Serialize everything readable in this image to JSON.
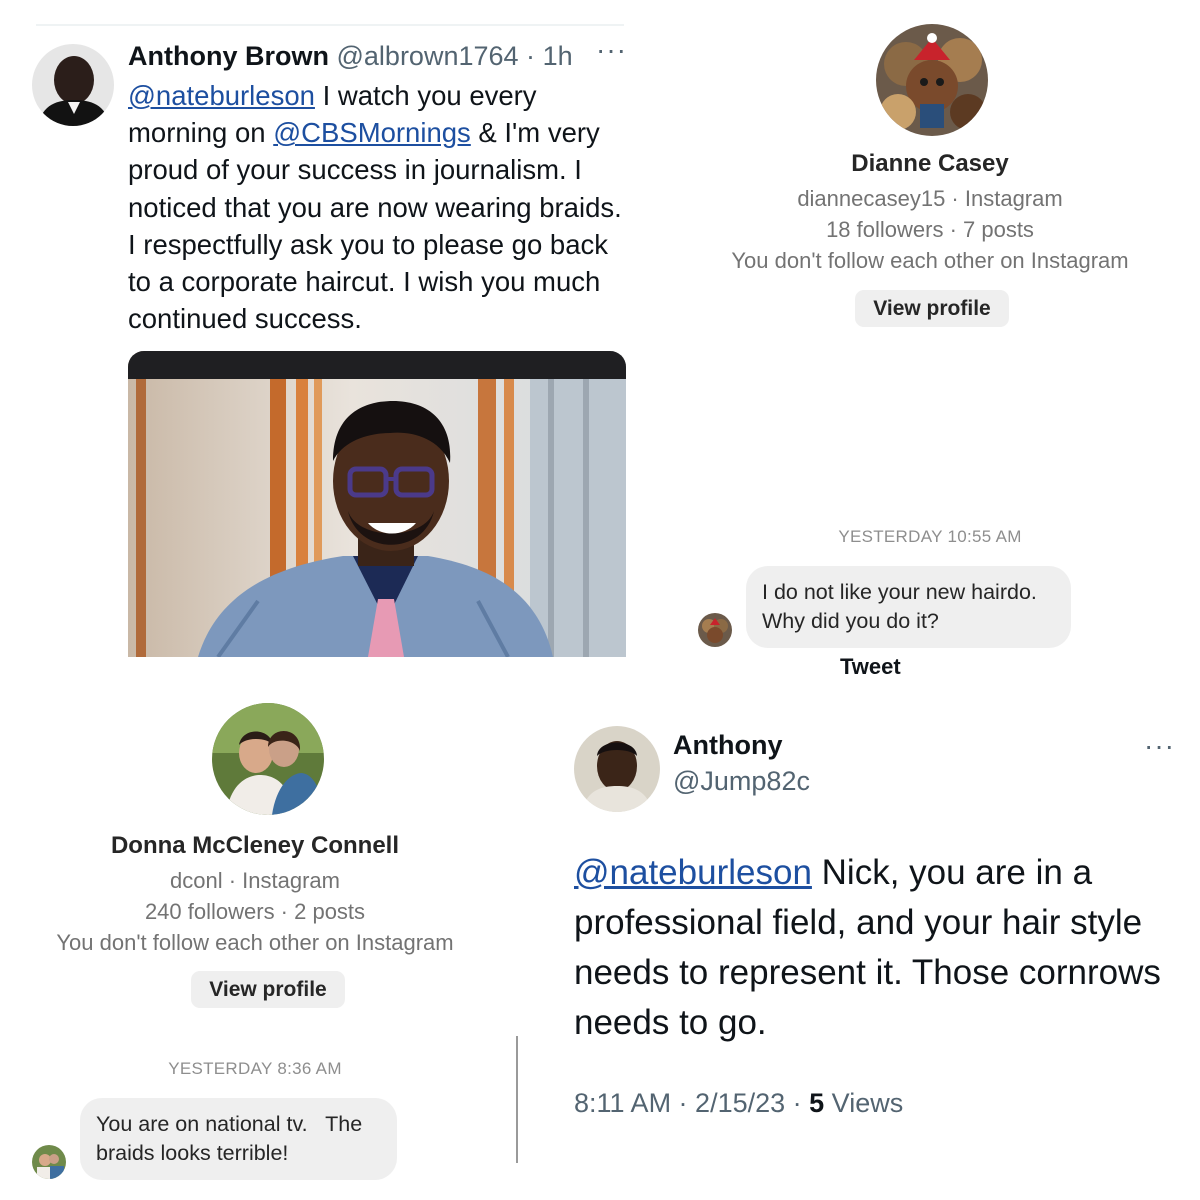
{
  "tweet1": {
    "author_name": "Anthony Brown",
    "handle": "@albrown1764",
    "separator": "·",
    "time": "1h",
    "more": "···",
    "mention1": "@nateburleson",
    "text1": " I watch you every morning on ",
    "mention2": "@CBSMornings",
    "text2": " & I'm very proud of your success in journalism. I noticed that you are now wearing braids. I respectfully ask you to please go back to a corporate haircut. I wish you much continued success."
  },
  "dm1": {
    "name": "Dianne Casey",
    "username_line": "diannecasey15 · Instagram",
    "stats": "18 followers · 7 posts",
    "follow_status": "You don't follow each other on Instagram",
    "button": "View profile",
    "timestamp": "YESTERDAY 10:55 AM",
    "message_line1": "I do not like your new hairdo.",
    "message_line2": "Why did you do it?",
    "cropped_label": "Tweet"
  },
  "dm2": {
    "name": "Donna McCleney Connell",
    "username_line": "dconl · Instagram",
    "stats": "240 followers · 2 posts",
    "follow_status": "You don't follow each other on Instagram",
    "button": "View profile",
    "timestamp": "YESTERDAY 8:36 AM",
    "message_line1": "You are on national tv.   The",
    "message_line2": "braids looks terrible!"
  },
  "tweet2": {
    "author_name": "Anthony",
    "handle": "@Jump82c",
    "more": "···",
    "mention": "@nateburleson",
    "text": " Nick, you are in a professional field, and your hair style needs to represent it. Those cornrows needs to go.",
    "time": "8:11 AM · 2/15/23 · ",
    "views_count": "5",
    "views_label": " Views"
  },
  "colors": {
    "twitter_text": "#0f1419",
    "twitter_secondary": "#536471",
    "mention": "#1d4fa0",
    "ig_bubble": "#efefef",
    "ig_secondary": "#737373"
  }
}
